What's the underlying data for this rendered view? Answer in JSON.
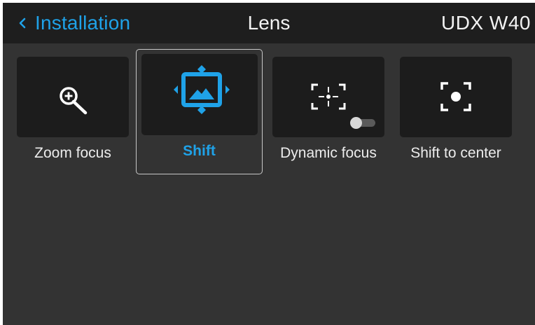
{
  "header": {
    "back_label": "Installation",
    "title": "Lens",
    "device": "UDX W40"
  },
  "tiles": [
    {
      "label": "Zoom focus",
      "icon": "zoom-in-icon",
      "selected": false
    },
    {
      "label": "Shift",
      "icon": "lens-shift-icon",
      "selected": true
    },
    {
      "label": "Dynamic focus",
      "icon": "dynamic-focus-icon",
      "selected": false,
      "toggle": "off"
    },
    {
      "label": "Shift to center",
      "icon": "center-focus-icon",
      "selected": false
    }
  ],
  "colors": {
    "accent": "#1fa2e8",
    "background": "#333333",
    "header_bg": "#1e1e1e",
    "card_bg": "#1c1c1c",
    "text": "#f2f2f2"
  }
}
